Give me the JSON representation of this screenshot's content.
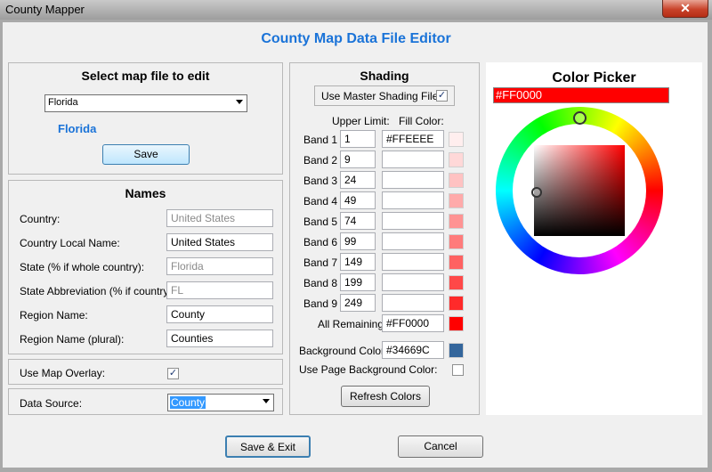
{
  "window": {
    "title": "County Mapper",
    "close_glyph": "✕"
  },
  "header": {
    "title": "County Map Data File Editor"
  },
  "map_file": {
    "title": "Select map file to edit",
    "selected": "Florida",
    "current_name": "Florida",
    "save_label": "Save"
  },
  "names": {
    "title": "Names",
    "fields": [
      {
        "label": "Country:",
        "value": "United States",
        "readonly": true
      },
      {
        "label": "Country Local Name:",
        "value": "United States",
        "readonly": false
      },
      {
        "label": "State (% if whole country):",
        "value": "Florida",
        "readonly": true
      },
      {
        "label": "State Abbreviation (% if country):",
        "value": "FL",
        "readonly": true
      },
      {
        "label": "Region Name:",
        "value": "County",
        "readonly": false
      },
      {
        "label": "Region Name (plural):",
        "value": "Counties",
        "readonly": false
      }
    ]
  },
  "overlay": {
    "label": "Use Map Overlay:",
    "checked": true,
    "check_glyph": "✓"
  },
  "data_source": {
    "label": "Data Source:",
    "selected": "County"
  },
  "shading": {
    "title": "Shading",
    "master_label": "Use Master Shading File:",
    "master_checked": true,
    "col_upper": "Upper Limit:",
    "col_fill": "Fill Color:",
    "bands": [
      {
        "label": "Band 1",
        "upper": "1",
        "fill": "#FFEEEE",
        "swatch": "#FFEEEE"
      },
      {
        "label": "Band 2",
        "upper": "9",
        "fill": "",
        "swatch": "#FFD8D8"
      },
      {
        "label": "Band 3",
        "upper": "24",
        "fill": "",
        "swatch": "#FFC2C2"
      },
      {
        "label": "Band 4",
        "upper": "49",
        "fill": "",
        "swatch": "#FFAAAA"
      },
      {
        "label": "Band 5",
        "upper": "74",
        "fill": "",
        "swatch": "#FF9393"
      },
      {
        "label": "Band 6",
        "upper": "99",
        "fill": "",
        "swatch": "#FF7B7B"
      },
      {
        "label": "Band 7",
        "upper": "149",
        "fill": "",
        "swatch": "#FF6262"
      },
      {
        "label": "Band 8",
        "upper": "199",
        "fill": "",
        "swatch": "#FF4848"
      },
      {
        "label": "Band 9",
        "upper": "249",
        "fill": "",
        "swatch": "#FF2A2A"
      }
    ],
    "remaining_label": "All Remaining:",
    "remaining_fill": "#FF0000",
    "remaining_swatch": "#FF0000",
    "background_label": "Background Color:",
    "background_value": "#34669C",
    "background_swatch": "#34669C",
    "page_bg_label": "Use Page Background Color:",
    "page_bg_checked": false,
    "refresh_label": "Refresh Colors"
  },
  "picker": {
    "title": "Color Picker",
    "hex": "#FF0000"
  },
  "footer": {
    "save_exit_label": "Save & Exit",
    "cancel_label": "Cancel"
  }
}
